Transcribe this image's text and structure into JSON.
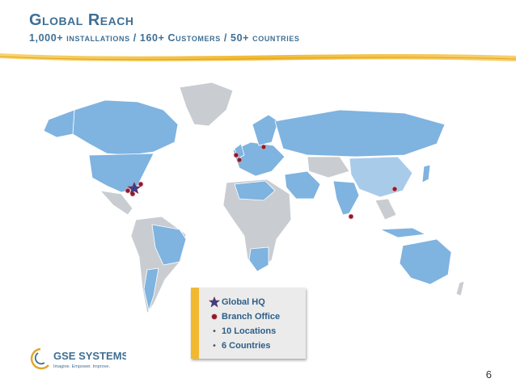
{
  "header": {
    "title": "Global Reach",
    "subtitle": "1,000+ installations / 160+ Customers / 50+ countries"
  },
  "legend": {
    "hq_label": "Global HQ",
    "branch_label": "Branch Office",
    "locations_text": "10 Locations",
    "countries_text": "6 Countries"
  },
  "logo": {
    "name": "GSE SYSTEMS",
    "tagline": "Imagine. Empower. Improve."
  },
  "footer": {
    "page_number": "6"
  },
  "colors": {
    "title": "#3f6f93",
    "accent_gold": "#f2b830",
    "country_active": "#7fb3e0",
    "country_inactive": "#c9cdd1",
    "marker": "#8e1b2b"
  }
}
